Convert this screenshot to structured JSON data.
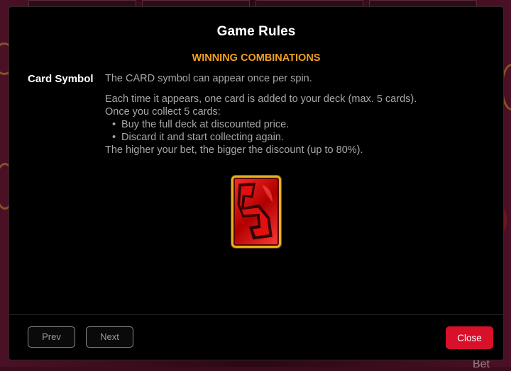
{
  "modal": {
    "title": "Game Rules",
    "section_title": "WINNING COMBINATIONS",
    "symbol_name": "Card Symbol",
    "description": {
      "line1": "The CARD symbol can appear once per spin.",
      "line2": "Each time it appears, one card is added to your deck (max. 5 cards).",
      "line3": "Once you collect 5 cards:",
      "bullets": [
        "Buy the full deck at discounted price.",
        "Discard it and start collecting again."
      ],
      "line4": "The higher your bet, the bigger the discount (up to 80%)."
    },
    "buttons": {
      "prev": "Prev",
      "next": "Next",
      "close": "Close"
    }
  },
  "background": {
    "bottom_partial_text": "Bet"
  },
  "colors": {
    "accent_orange": "#f0a020",
    "close_red": "#d8102a",
    "card_gold": "#e7b020",
    "card_red": "#ff2a2a"
  }
}
